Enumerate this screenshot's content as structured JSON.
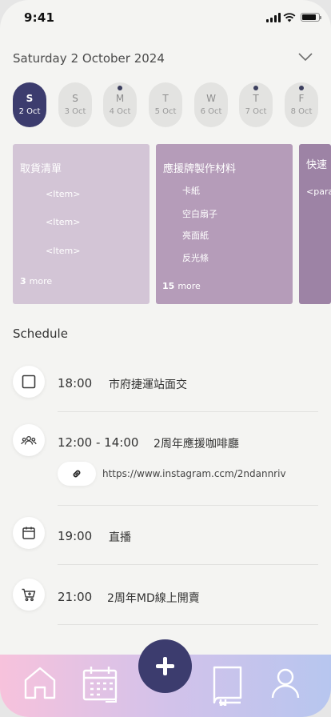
{
  "status_bar": {
    "time": "9:41"
  },
  "header": {
    "weekday": "Saturday",
    "date": "2 October 2024"
  },
  "week": [
    {
      "letter": "S",
      "num": "2 Oct",
      "active": true,
      "dot": false
    },
    {
      "letter": "S",
      "num": "3 Oct",
      "active": false,
      "dot": false
    },
    {
      "letter": "M",
      "num": "4 Oct",
      "active": false,
      "dot": true
    },
    {
      "letter": "T",
      "num": "5 Oct",
      "active": false,
      "dot": false
    },
    {
      "letter": "W",
      "num": "6 Oct",
      "active": false,
      "dot": false
    },
    {
      "letter": "T",
      "num": "7 Oct",
      "active": false,
      "dot": true
    },
    {
      "letter": "F",
      "num": "8 Oct",
      "active": false,
      "dot": true
    }
  ],
  "cards": [
    {
      "title": "取貨清單",
      "items": [
        "<Item>",
        "<Item>",
        "<Item>"
      ],
      "more_count": "3",
      "more_label": "more",
      "color": "#d3c5d6"
    },
    {
      "title": "應援牌製作材料",
      "items": [
        "卡紙",
        "空白扇子",
        "亮面紙",
        "反光條"
      ],
      "more_count": "15",
      "more_label": "more",
      "color": "#b59cb9"
    },
    {
      "title": "快速",
      "items": [
        "<para"
      ],
      "more_count": "",
      "more_label": "",
      "color": "#9d83a5"
    }
  ],
  "schedule": {
    "title": "Schedule",
    "events": [
      {
        "icon": "checkbox-icon",
        "time": "18:00",
        "title": "市府捷運站面交"
      },
      {
        "icon": "group-icon",
        "time": "12:00 - 14:00",
        "title": "2周年應援咖啡廳",
        "link": "https://www.instagram.ccm/2ndannriv"
      },
      {
        "icon": "calendar-icon",
        "time": "19:00",
        "title": "直播"
      },
      {
        "icon": "cart-icon",
        "time": "21:00",
        "title": "2周年MD線上開賣"
      }
    ]
  },
  "tabbar": {
    "tabs": [
      "home-icon",
      "calendar-icon",
      "add-icon",
      "book-icon",
      "profile-icon"
    ]
  }
}
